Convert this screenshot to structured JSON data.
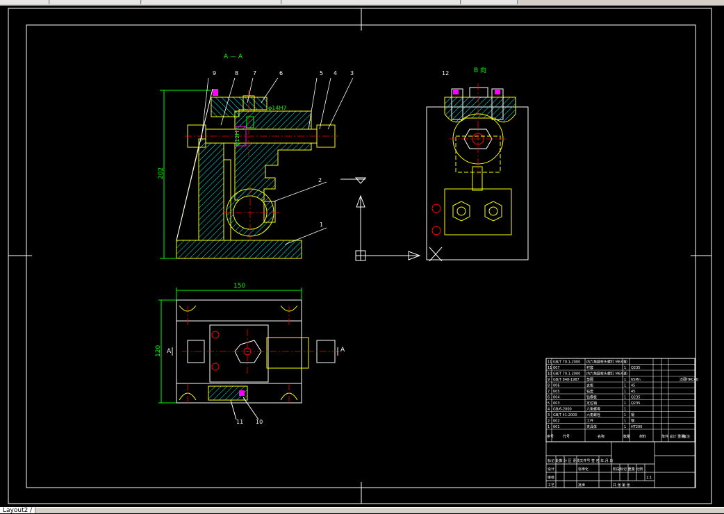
{
  "layout_tab": "Layout2 /",
  "sections": {
    "section_aa": "A — A",
    "view_b": "B 向",
    "section_mark": "A"
  },
  "dimensions": {
    "height_202": "202",
    "width_150": "150",
    "height_120": "120",
    "fit_phi14": "φ14H7",
    "fit_phi12": "φ12H7"
  },
  "balloons": [
    "9",
    "8",
    "7",
    "6",
    "5",
    "4",
    "3",
    "2",
    "1",
    "12",
    "11",
    "10"
  ],
  "parts_list": {
    "rows": [
      {
        "no": "11",
        "code": "GB/T 70.1-2000",
        "name": "内六角圆柱头螺钉 M6X30",
        "qty": "1",
        "mat": "",
        "note": ""
      },
      {
        "no": "11",
        "code": "007",
        "name": "衬套",
        "qty": "1",
        "mat": "Q235",
        "note": ""
      },
      {
        "no": "10",
        "code": "GB/T 70.1-2000",
        "name": "内六角圆柱头螺钉 M6X30",
        "qty": "2",
        "mat": "",
        "note": ""
      },
      {
        "no": "9",
        "code": "GB/T 848-1987",
        "name": "垫圈",
        "qty": "1",
        "mat": "65Mn",
        "note": "淬硬HRC40"
      },
      {
        "no": "8",
        "code": "006",
        "name": "支板",
        "qty": "1",
        "mat": "45",
        "note": ""
      },
      {
        "no": "7",
        "code": "005",
        "name": "钻套",
        "qty": "1",
        "mat": "45",
        "note": ""
      },
      {
        "no": "6",
        "code": "004",
        "name": "钻模板",
        "qty": "1",
        "mat": "Q235",
        "note": ""
      },
      {
        "no": "5",
        "code": "003",
        "name": "定位销",
        "qty": "1",
        "mat": "Q235",
        "note": ""
      },
      {
        "no": "4",
        "code": "GB/6-2000",
        "name": "六角螺母",
        "qty": "1",
        "mat": "",
        "note": ""
      },
      {
        "no": "3",
        "code": "GB/T 41-2000",
        "name": "六角螺栓",
        "qty": "1",
        "mat": "钢",
        "note": ""
      },
      {
        "no": "2",
        "code": "002",
        "name": "工件",
        "qty": "1",
        "mat": "钢",
        "note": ""
      },
      {
        "no": "1",
        "code": "001",
        "name": "夹具体",
        "qty": "1",
        "mat": "HT200",
        "note": ""
      }
    ],
    "header": {
      "no": "序号",
      "code": "代号",
      "name": "名称",
      "qty": "数量",
      "mat": "材料",
      "weight": "单件 总计 重量",
      "note": "备注"
    }
  },
  "title_block": {
    "r1": "标记 处数 分 区 更改文件号 签 名 年.月.日",
    "design": "设计",
    "standard": "标准化",
    "stage": "阶段标记 重量 比例",
    "scale": "1:1",
    "audit": "审核",
    "craft": "工艺",
    "approve": "批准",
    "sheet": "共 张 第 张"
  },
  "colors": {
    "frame": "#ffffff",
    "outline": "#ffff00",
    "hatch": "#00ffff",
    "center": "#ff0000",
    "dimension": "#00ff00",
    "magenta": "#ff00ff"
  }
}
